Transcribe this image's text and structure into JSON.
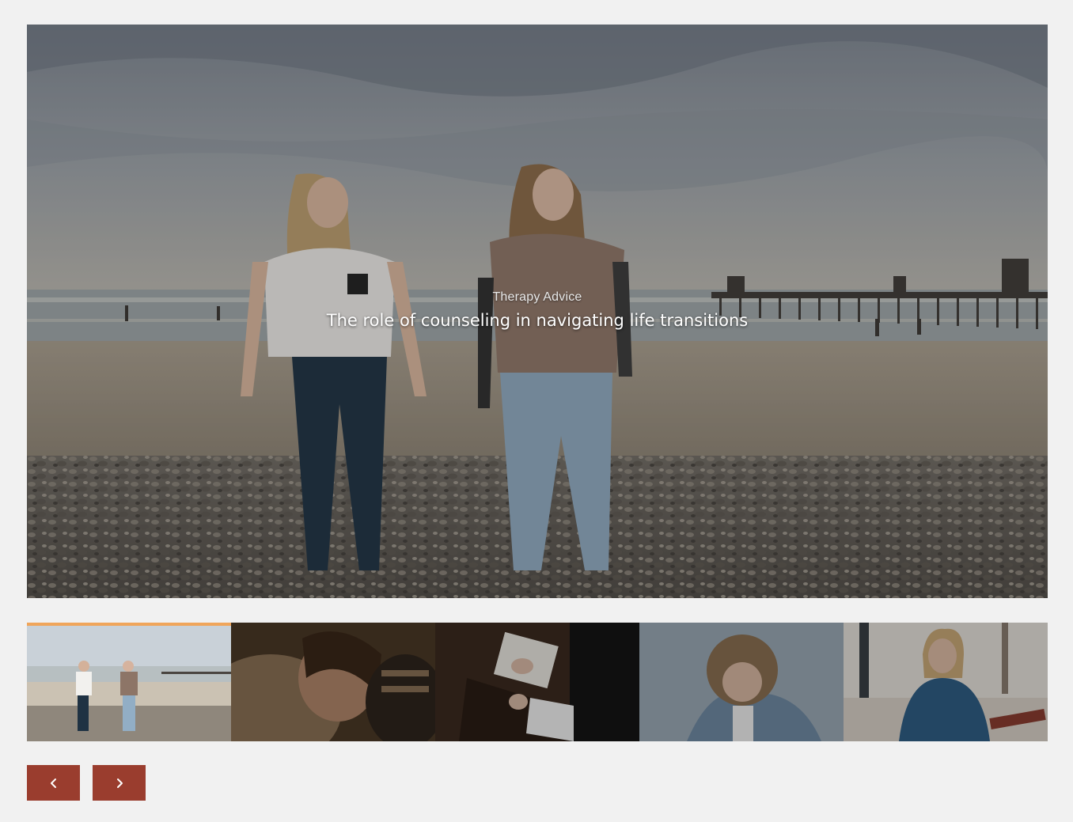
{
  "hero": {
    "category": "Therapy Advice",
    "title": "The role of counseling in navigating life transitions",
    "image_alt": "Two young women laughing while walking on a pebble beach near a pier"
  },
  "thumbnails": [
    {
      "alt": "Two women walking on beach",
      "active": true
    },
    {
      "alt": "Smiling child hugging",
      "active": false
    },
    {
      "alt": "Person taking notes in a session",
      "active": false
    },
    {
      "alt": "Person in denim jacket looking down",
      "active": false
    },
    {
      "alt": "Smiling woman with glasses holding tablet",
      "active": false
    }
  ],
  "controls": {
    "prev_label": "Previous slide",
    "next_label": "Next slide"
  },
  "colors": {
    "page_background": "#f1f1f1",
    "button_background": "#9a3d2e",
    "active_thumb_indicator": "#f0a55a"
  },
  "icons": {
    "prev": "chevron-left-icon",
    "next": "chevron-right-icon"
  }
}
